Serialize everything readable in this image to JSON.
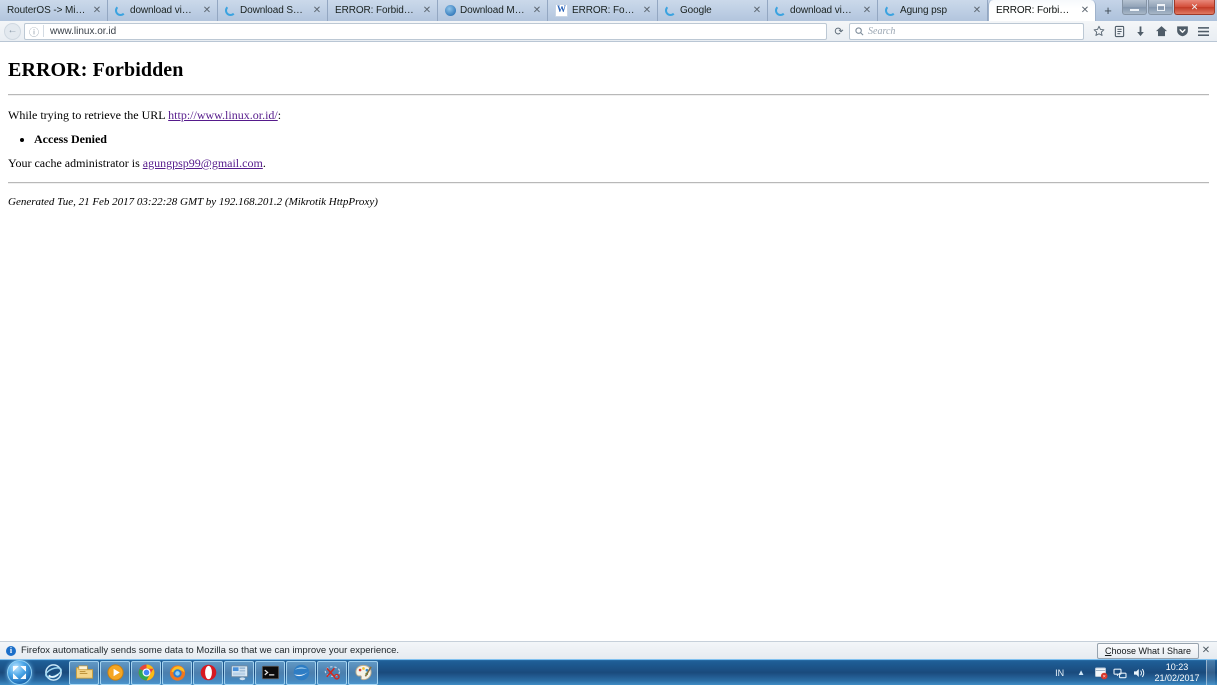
{
  "window": {
    "controls": {
      "minimize": "–",
      "maximize": "❐",
      "close": "✕"
    }
  },
  "tabs": [
    {
      "title": "RouterOS -> MikroTik -...",
      "favicon": "none-icon",
      "active": false,
      "close": "✕",
      "width": 108
    },
    {
      "title": "download vidoe mk...",
      "favicon": "loading-spinner-icon",
      "active": false,
      "close": "✕",
      "width": 110
    },
    {
      "title": "Download Sample ...",
      "favicon": "loading-spinner-icon",
      "active": false,
      "close": "✕",
      "width": 110
    },
    {
      "title": "ERROR: Forbidden",
      "favicon": "none-icon",
      "active": false,
      "close": "✕",
      "width": 110
    },
    {
      "title": "Download Miley Cy...",
      "favicon": "blue-globe-icon",
      "active": false,
      "close": "✕",
      "width": 110
    },
    {
      "title": "ERROR: Forbidden",
      "favicon": "wikipedia-w-icon",
      "active": false,
      "close": "✕",
      "width": 110
    },
    {
      "title": "Google",
      "favicon": "loading-spinner-icon",
      "active": false,
      "close": "✕",
      "width": 110
    },
    {
      "title": "download video mk...",
      "favicon": "loading-spinner-icon",
      "active": false,
      "close": "✕",
      "width": 110
    },
    {
      "title": "Agung psp",
      "favicon": "loading-spinner-icon",
      "active": false,
      "close": "✕",
      "width": 110
    },
    {
      "title": "ERROR: Forbidden",
      "favicon": "none-icon",
      "active": true,
      "close": "✕",
      "width": 108
    }
  ],
  "newtab": {
    "label": "+"
  },
  "toolbar": {
    "back_glyph": "←",
    "identity_glyph": "ⓘ",
    "url_value": "www.linux.or.id",
    "reload_glyph": "⟳",
    "search_placeholder": "Search",
    "bookmark_icon": "star-icon",
    "reader_icon": "reader-list-icon",
    "downloads_icon": "download-arrow-icon",
    "home_icon": "home-icon",
    "sync_icon": "pocket-shield-icon",
    "menu_icon": "hamburger-menu-icon"
  },
  "page": {
    "title": "ERROR: Forbidden",
    "intro_prefix": "While trying to retrieve the URL ",
    "intro_link": "http://www.linux.or.id/",
    "intro_suffix": ":",
    "denied_items": [
      "Access Denied"
    ],
    "admin_prefix": "Your cache administrator is ",
    "admin_email": "agungpsp99@gmail.com",
    "admin_suffix": ".",
    "generated": "Generated Tue, 21 Feb 2017 03:22:28 GMT by 192.168.201.2 (Mikrotik HttpProxy)"
  },
  "notification": {
    "icon": "info-icon",
    "badge_char": "i",
    "message": "Firefox automatically sends some data to Mozilla so that we can improve your experience.",
    "button_underlined": "C",
    "button_rest": "hoose What I Share",
    "close": "✕"
  },
  "taskbar": {
    "start": "windows-start-orb-icon",
    "quick_launch": [
      {
        "name": "internet-explorer-icon",
        "framed": false
      },
      {
        "name": "windows-explorer-icon",
        "framed": true
      },
      {
        "name": "media-player-icon",
        "framed": true
      },
      {
        "name": "google-chrome-icon",
        "framed": true
      },
      {
        "name": "mozilla-firefox-icon",
        "framed": true
      },
      {
        "name": "opera-browser-icon",
        "framed": true
      },
      {
        "name": "winbox-mikrotik-icon",
        "framed": true
      },
      {
        "name": "command-prompt-icon",
        "framed": true
      },
      {
        "name": "blue-swirl-app-icon",
        "framed": true
      },
      {
        "name": "snipping-tool-icon",
        "framed": true
      },
      {
        "name": "ms-paint-icon",
        "framed": true
      }
    ],
    "tray": {
      "language": "IN",
      "show_hidden_glyph": "▲",
      "action_center_icon": "flag-alert-icon",
      "network_icon": "network-icon",
      "volume_icon": "speaker-icon",
      "time": "10:23",
      "date": "21/02/2017"
    }
  }
}
